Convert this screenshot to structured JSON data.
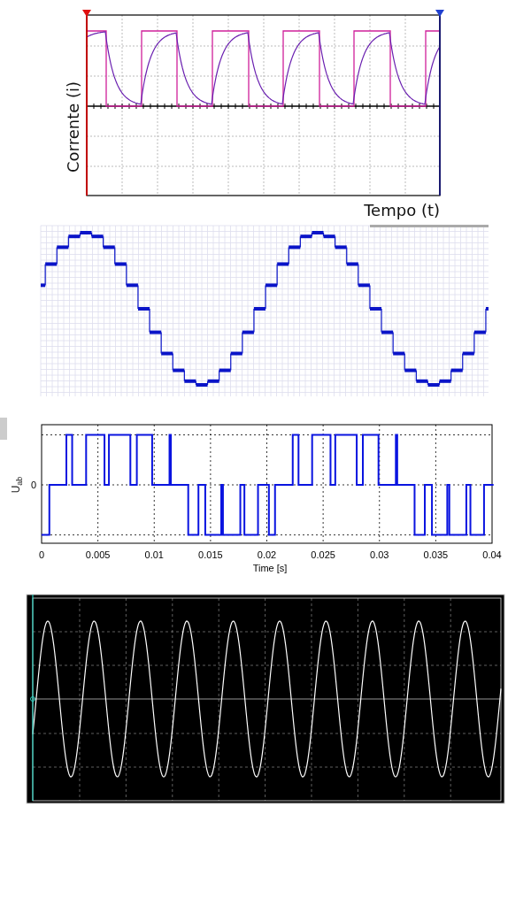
{
  "current_plot": {
    "ylabel": "Corrente (i)",
    "xlabel": "Tempo (t)"
  },
  "voltage_plot": {
    "ylabel": "U$_{ab}$",
    "ytick": "0",
    "xticks": [
      "0",
      "0.005",
      "0.01",
      "0.015",
      "0.02",
      "0.025",
      "0.03",
      "0.035",
      "0.04"
    ],
    "xlabel": "Time [s]"
  }
}
